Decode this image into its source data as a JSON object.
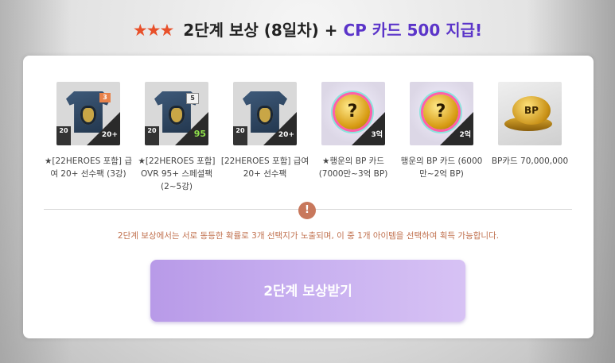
{
  "header": {
    "stars": "★★★",
    "title_main": "2단계 보상 (8일차) +",
    "title_accent": "CP 카드 500 지급!"
  },
  "rewards": [
    {
      "icon": "jersey-pack-icon",
      "badge_left": "20",
      "badge_corner": "20+",
      "jersey_tag": "3",
      "label": "★[22HEROES 포함] 급여 20+ 선수팩 (3강)"
    },
    {
      "icon": "jersey-pack-icon",
      "badge_left": "20",
      "badge_corner": "95",
      "jersey_tag": "5",
      "label": "★[22HEROES 포함] OVR 95+ 스페셜팩 (2~5강)"
    },
    {
      "icon": "jersey-pack-icon",
      "badge_left": "20",
      "badge_corner": "20+",
      "jersey_tag": "",
      "label": "[22HEROES 포함] 급여 20+ 선수팩"
    },
    {
      "icon": "lucky-bp-card-icon",
      "badge_corner": "3억",
      "coin_symbol": "?",
      "label": "★행운의 BP 카드 (7000만~3억 BP)"
    },
    {
      "icon": "lucky-bp-card-icon",
      "badge_corner": "2억",
      "coin_symbol": "?",
      "label": "행운의 BP 카드 (6000만~2억 BP)"
    },
    {
      "icon": "bp-coins-icon",
      "coin_symbol": "BP",
      "label": "BP카드 70,000,000"
    }
  ],
  "notice": {
    "icon_symbol": "!",
    "text": "2단계 보상에서는 서로 동등한 확률로 3개 선택지가 노출되며, 이 중 1개 아이템을 선택하여 획득 가능합니다."
  },
  "claim_button": {
    "label": "2단계 보상받기"
  },
  "colors": {
    "accent": "#5b34c9",
    "stars": "#e8502a",
    "notice": "#c0704e",
    "button": "#c8b0f0"
  }
}
